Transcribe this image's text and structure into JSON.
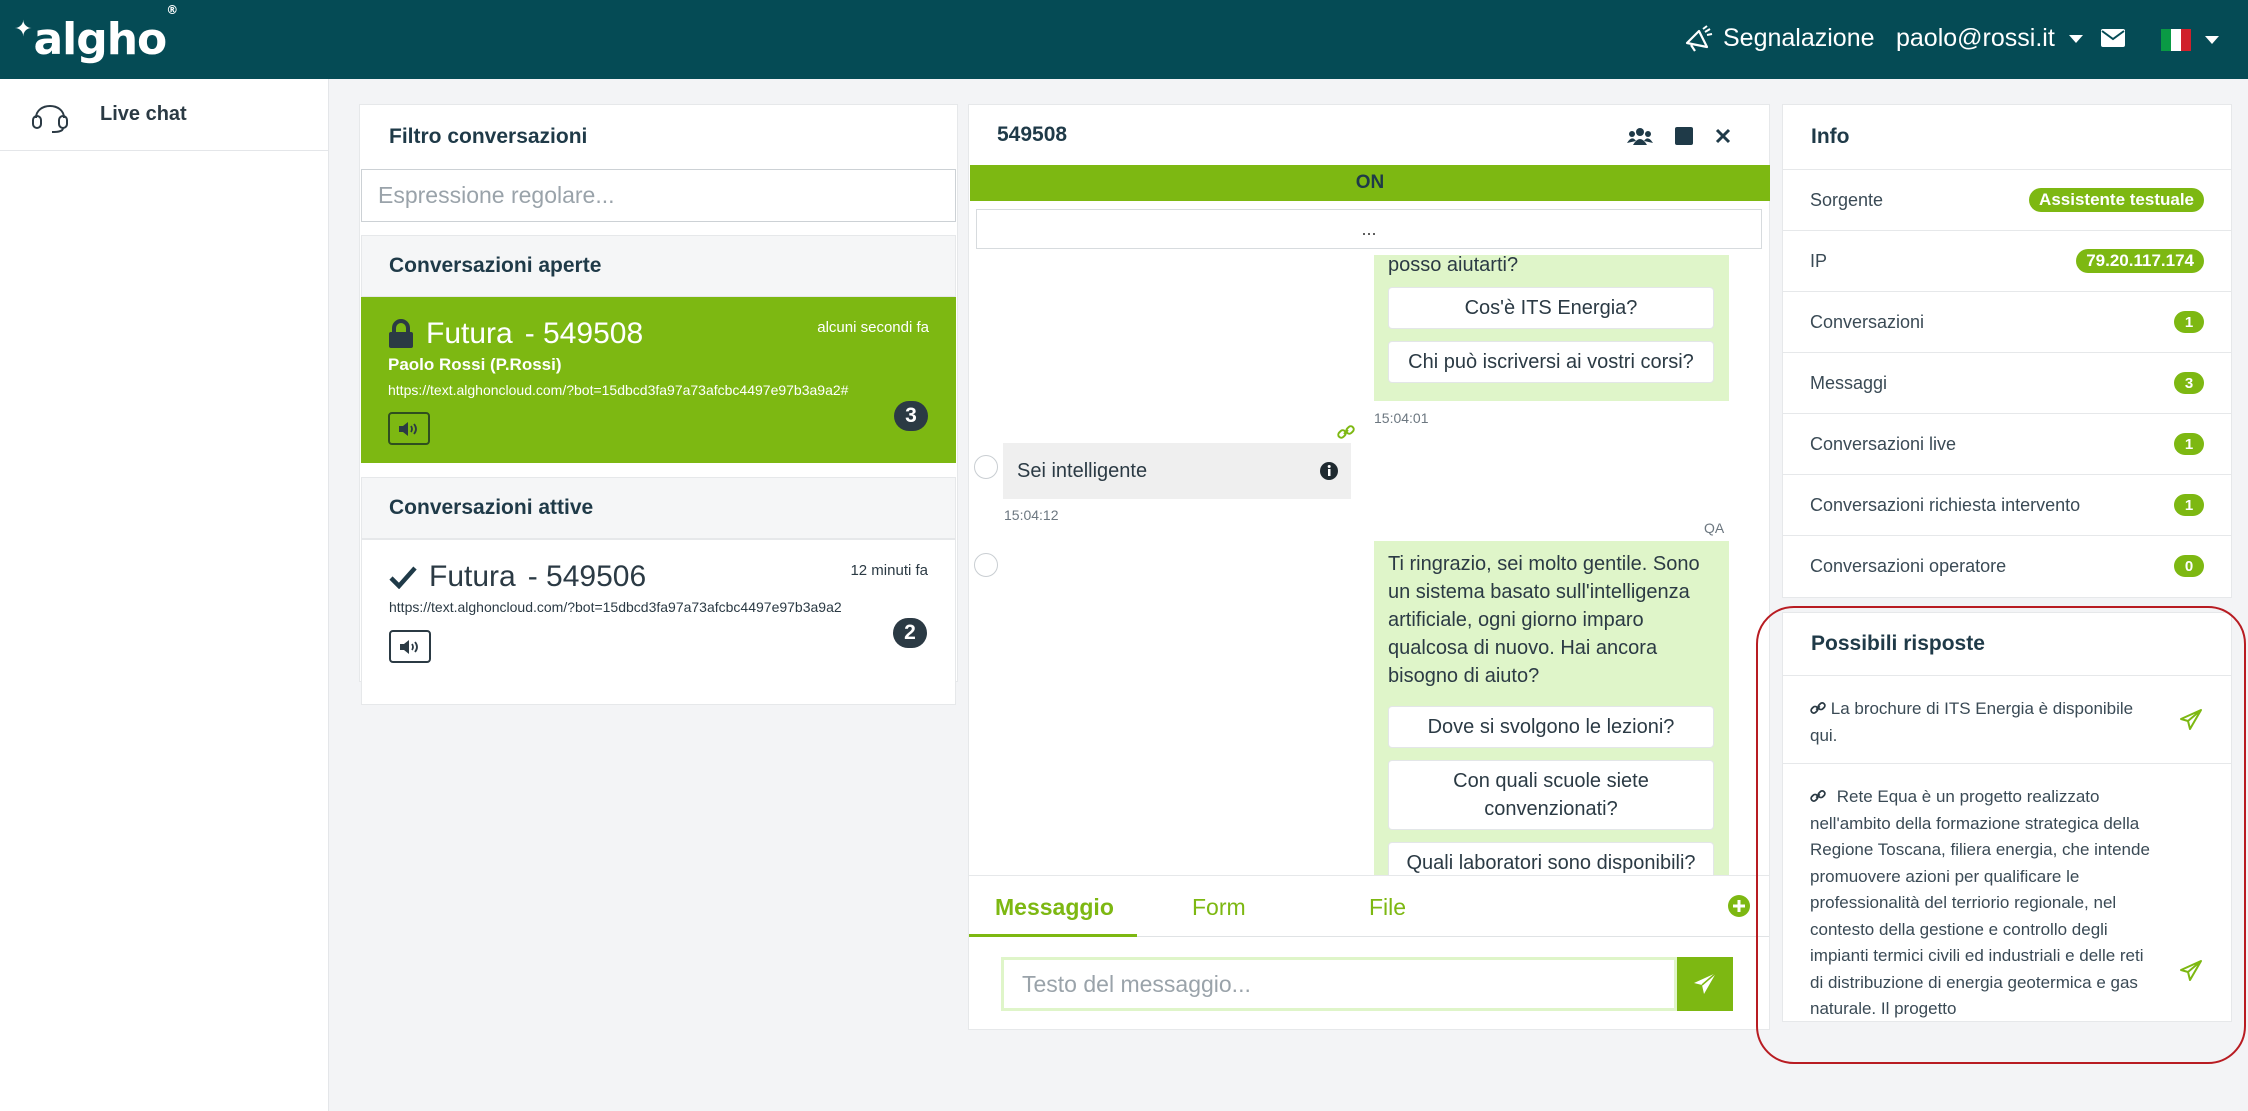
{
  "topbar": {
    "logo": "algho",
    "report_label": "Segnalazione",
    "user_email": "paolo@rossi.it"
  },
  "sidebar": {
    "items": [
      {
        "label": "Live chat",
        "icon": "headset-icon"
      }
    ]
  },
  "filter": {
    "title": "Filtro conversazioni",
    "placeholder": "Espressione regolare..."
  },
  "open_conversations": {
    "title": "Conversazioni aperte",
    "items": [
      {
        "name": "Futura",
        "id": "- 549508",
        "time": "alcuni secondi fa",
        "user": "Paolo Rossi (P.Rossi)",
        "url": "https://text.alghoncloud.com/?bot=15dbcd3fa97a73afcbc4497e97b3a9a2#",
        "count": "3"
      }
    ]
  },
  "active_conversations": {
    "title": "Conversazioni attive",
    "items": [
      {
        "name": "Futura",
        "id": "- 549506",
        "time": "12 minuti fa",
        "url": "https://text.alghoncloud.com/?bot=15dbcd3fa97a73afcbc4497e97b3a9a2",
        "count": "2"
      }
    ]
  },
  "chat": {
    "id": "549508",
    "status": "ON",
    "more": "...",
    "messages": {
      "bot1_tail": "posso aiutarti?",
      "bot1_buttons": [
        "Cos'è ITS Energia?",
        "Chi può iscriversi ai vostri corsi?"
      ],
      "bot1_time": "15:04:01",
      "user1_text": "Sei intelligente",
      "user1_time": "15:04:12",
      "qa_label": "QA",
      "bot2_lines": [
        "Ti ringrazio, sei molto gentile. Sono",
        "un sistema basato sull'intelligenza",
        "artificiale, ogni giorno imparo",
        "qualcosa di nuovo. Hai ancora",
        "bisogno di aiuto?"
      ],
      "bot2_buttons": [
        "Dove si svolgono le lezioni?",
        "Con quali scuole siete convenzionati?",
        "Quali laboratori sono disponibili?"
      ]
    },
    "tabs": [
      "Messaggio",
      "Form",
      "File"
    ],
    "input_placeholder": "Testo del messaggio..."
  },
  "info": {
    "title": "Info",
    "rows": [
      {
        "label": "Sorgente",
        "value": "Assistente testuale"
      },
      {
        "label": "IP",
        "value": "79.20.117.174"
      },
      {
        "label": "Conversazioni",
        "value": "1"
      },
      {
        "label": "Messaggi",
        "value": "3"
      },
      {
        "label": "Conversazioni live",
        "value": "1"
      },
      {
        "label": "Conversazioni richiesta intervento",
        "value": "1"
      },
      {
        "label": "Conversazioni operatore",
        "value": "0"
      }
    ]
  },
  "answers": {
    "title": "Possibili risposte",
    "items": [
      "La brochure di ITS Energia è disponibile qui.",
      "Rete Equa è un progetto realizzato nell'ambito della formazione strategica della Regione Toscana, filiera energia, che intende promuovere azioni per qualificare le professionalità del terriorio regionale, nel contesto della gestione e controllo degli impianti termici civili ed industriali e delle reti di distribuzione di energia geotermica e gas naturale. Il progetto"
    ]
  },
  "colors": {
    "topbar": "#054b55",
    "accent": "#7db812",
    "bubble": "#dff5c9",
    "highlight": "#b81c22"
  }
}
